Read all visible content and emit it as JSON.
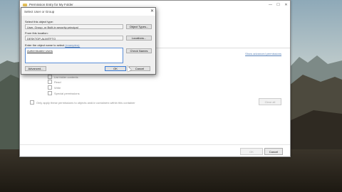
{
  "main_window": {
    "title": "Permission Entry for My Folder",
    "controls": {
      "minimize": "—",
      "maximize": "☐",
      "close": "✕"
    },
    "show_advanced": "Show advanced permissions",
    "checkboxes": [
      {
        "label": "List folder contents"
      },
      {
        "label": "Read"
      },
      {
        "label": "Write"
      },
      {
        "label": "Special permissions"
      }
    ],
    "apply_checkbox": "Only apply these permissions to objects and/or containers within this container",
    "clear_all": "Clear all",
    "ok": "OK",
    "cancel": "Cancel"
  },
  "dialog": {
    "title": "Select User or Group",
    "close": "✕",
    "object_type_label": "Select this object type:",
    "object_type_value": "User, Group, or Built-in security principal",
    "object_types_button": "Object Types...",
    "location_label": "From this location:",
    "location_value": "DESKTOP-ALMITFTO",
    "locations_button": "Locations...",
    "enter_label": "Enter the object name to select",
    "examples_link": "(examples):",
    "entered_name": "Authenticated Users",
    "check_names_button": "Check Names",
    "advanced_button": "Advanced...",
    "ok_button": "OK",
    "cancel_button": "Cancel"
  }
}
